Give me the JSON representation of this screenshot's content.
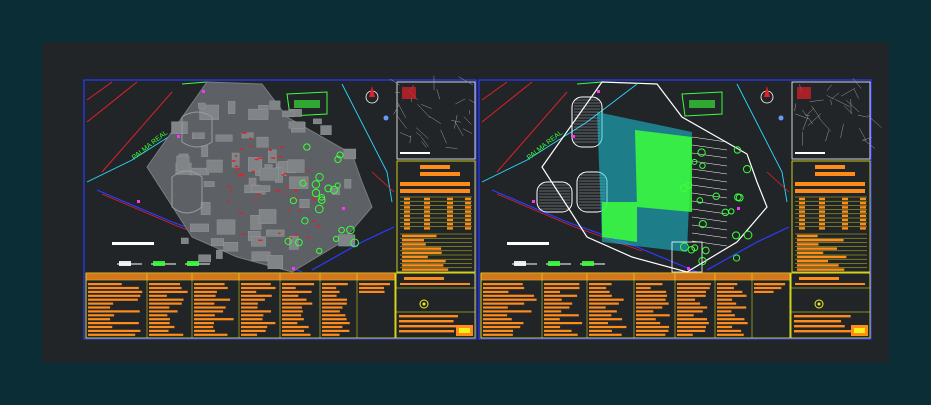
{
  "app": {
    "background_color": "#0b2e36",
    "canvas_color": "#222528"
  },
  "sheets": [
    {
      "id": "sheet-1",
      "street_label": "PALMA REAL",
      "street_label_2": "",
      "scale_bar": [
        "",
        "",
        ""
      ],
      "plan_type": "existing"
    },
    {
      "id": "sheet-2",
      "street_label": "PALMA REAL",
      "street_label_2": "",
      "scale_bar": [
        "",
        "",
        ""
      ],
      "plan_type": "proposed"
    }
  ],
  "colors": {
    "frame_blue": "#2a3cff",
    "table_orange": "#ff8c1a",
    "table_yellow": "#f2f21a",
    "plan_grey": "#7a7d80",
    "hatch_green": "#3cff3c",
    "hatch_cyan": "#19c6d8",
    "boundary_red": "#e0202a",
    "road_cyan": "#29d9ff",
    "accent_magenta": "#ff33ff"
  }
}
